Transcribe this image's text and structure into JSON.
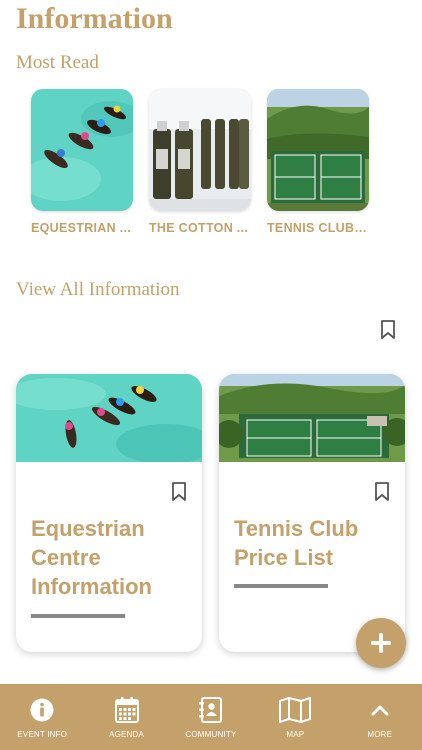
{
  "page": {
    "title": "Information"
  },
  "most_read": {
    "title": "Most Read",
    "items": [
      {
        "label": "EQUESTRIAN ...",
        "image": "horses-swimming"
      },
      {
        "label": "THE COTTON ...",
        "image": "toiletry-bottles"
      },
      {
        "label": "TENNIS CLUB ...",
        "image": "tennis-courts"
      }
    ]
  },
  "view_all": {
    "label": "View All Information"
  },
  "cards": [
    {
      "title_line1": "Equestrian",
      "title_line2": "Centre",
      "title_line3": "Information",
      "image": "horses-swimming"
    },
    {
      "title_line1": "Tennis Club",
      "title_line2": "Price List",
      "image": "tennis-courts"
    }
  ],
  "fab": {
    "icon": "plus-icon"
  },
  "bottom_nav": [
    {
      "label": "EVENT INFO",
      "icon": "info-icon"
    },
    {
      "label": "AGENDA",
      "icon": "calendar-icon"
    },
    {
      "label": "COMMUNITY",
      "icon": "contact-book-icon"
    },
    {
      "label": "MAP",
      "icon": "map-icon"
    },
    {
      "label": "MORE",
      "icon": "chevron-up-icon"
    }
  ],
  "colors": {
    "accent": "#c4a06a",
    "divider": "#888888",
    "background": "#ffffff"
  }
}
